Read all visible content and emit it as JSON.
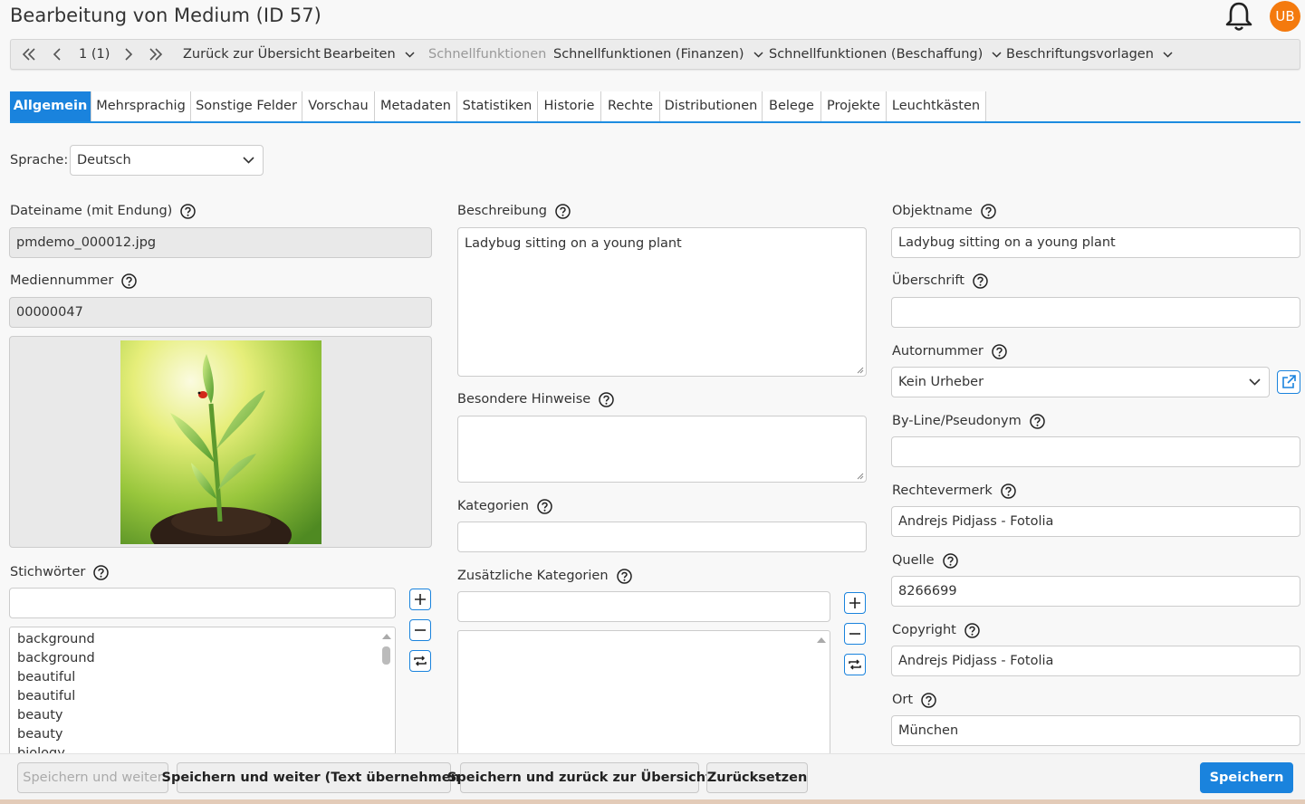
{
  "header": {
    "title": "Bearbeitung von Medium (ID 57)",
    "avatar_initials": "UB"
  },
  "toolbar": {
    "page_indicator": "1 (1)",
    "back_to_overview": "Zurück zur Übersicht",
    "edit": "Bearbeiten",
    "quick_functions": "Schnellfunktionen",
    "quick_finance": "Schnellfunktionen (Finanzen)",
    "quick_procurement": "Schnellfunktionen (Beschaffung)",
    "label_templates": "Beschriftungsvorlagen"
  },
  "tabs": [
    {
      "label": "Allgemein"
    },
    {
      "label": "Mehrsprachig"
    },
    {
      "label": "Sonstige Felder"
    },
    {
      "label": "Vorschau"
    },
    {
      "label": "Metadaten"
    },
    {
      "label": "Statistiken"
    },
    {
      "label": "Historie"
    },
    {
      "label": "Rechte"
    },
    {
      "label": "Distributionen"
    },
    {
      "label": "Belege"
    },
    {
      "label": "Projekte"
    },
    {
      "label": "Leuchtkästen"
    }
  ],
  "language": {
    "label": "Sprache:",
    "value": "Deutsch"
  },
  "left": {
    "filename_label": "Dateiname (mit Endung)",
    "filename_value": "pmdemo_000012.jpg",
    "medianumber_label": "Mediennummer",
    "medianumber_value": "00000047",
    "keywords_label": "Stichwörter",
    "keywords_input": "",
    "keywords": [
      "background",
      "background",
      "beautiful",
      "beautiful",
      "beauty",
      "beauty",
      "biology"
    ]
  },
  "middle": {
    "description_label": "Beschreibung",
    "description_value": "Ladybug sitting on a young plant",
    "notes_label": "Besondere Hinweise",
    "notes_value": "",
    "categories_label": "Kategorien",
    "categories_value": "",
    "extra_categories_label": "Zusätzliche Kategorien",
    "extra_categories_input": ""
  },
  "right": {
    "objectname_label": "Objektname",
    "objectname_value": "Ladybug sitting on a young plant",
    "headline_label": "Überschrift",
    "headline_value": "",
    "author_label": "Autornummer",
    "author_value": "Kein Urheber",
    "byline_label": "By-Line/Pseudonym",
    "byline_value": "",
    "rights_label": "Rechtevermerk",
    "rights_value": "Andrejs Pidjass - Fotolia",
    "source_label": "Quelle",
    "source_value": "8266699",
    "copyright_label": "Copyright",
    "copyright_value": "Andrejs Pidjass - Fotolia",
    "location_label": "Ort",
    "location_value": "München"
  },
  "footer": {
    "save_next": "Speichern und weiter",
    "save_next_text": "Speichern und weiter (Text übernehmen)",
    "save_back": "Speichern und zurück zur Übersicht",
    "reset": "Zurücksetzen",
    "save": "Speichern"
  },
  "colors": {
    "accent": "#1a83dd",
    "avatar": "#f47a0e"
  }
}
